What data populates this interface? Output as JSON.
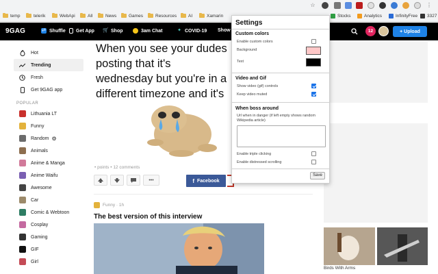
{
  "bookmarks": [
    {
      "label": "temp",
      "type": "folder"
    },
    {
      "label": "telerik",
      "type": "folder"
    },
    {
      "label": "WebApi",
      "type": "folder"
    },
    {
      "label": "All",
      "type": "folder"
    },
    {
      "label": "News",
      "type": "folder"
    },
    {
      "label": "Games",
      "type": "folder"
    },
    {
      "label": "Resources",
      "type": "folder"
    },
    {
      "label": "AI",
      "type": "folder"
    },
    {
      "label": "Xamarin",
      "type": "folder"
    },
    {
      "label": "Stocks",
      "type": "site"
    },
    {
      "label": "Analytics",
      "type": "site"
    },
    {
      "label": "InfinityFree",
      "type": "site"
    },
    {
      "label": "3327",
      "type": "site"
    }
  ],
  "header": {
    "logo": "9GAG",
    "nav": [
      {
        "label": "Shuffle",
        "icon": "shuffle-icon"
      },
      {
        "label": "Get App",
        "icon": "phone-icon"
      },
      {
        "label": "Shop",
        "icon": "cart-icon"
      },
      {
        "label": "3am Chat",
        "icon": "moon-icon"
      },
      {
        "label": "COVID-19",
        "icon": "virus-icon"
      },
      {
        "label": "Show",
        "icon": ""
      }
    ],
    "notifications": "12",
    "upload": "+ Upload"
  },
  "sidebar": {
    "top_items": [
      {
        "label": "Hot",
        "icon": "fire-icon"
      },
      {
        "label": "Trending",
        "icon": "trending-icon",
        "active": true
      },
      {
        "label": "Fresh",
        "icon": "clock-icon"
      },
      {
        "label": "Get 9GAG app",
        "icon": "phone-icon"
      }
    ],
    "popular_label": "POPULAR",
    "popular_items": [
      {
        "label": "Lithuania LT",
        "color": "#c9302c"
      },
      {
        "label": "Funny",
        "color": "#e3b23c"
      },
      {
        "label": "Random",
        "color": "#6b6b6b"
      },
      {
        "label": "Animals",
        "color": "#8d6e4f"
      },
      {
        "label": "Anime & Manga",
        "color": "#d17a9a"
      },
      {
        "label": "Anime Waifu",
        "color": "#7a5fb2"
      },
      {
        "label": "Awesome",
        "color": "#444444"
      },
      {
        "label": "Car",
        "color": "#9c8a6a"
      },
      {
        "label": "Comic & Webtoon",
        "color": "#2e7d63"
      },
      {
        "label": "Cosplay",
        "color": "#c46aa0"
      },
      {
        "label": "Gaming",
        "color": "#333333"
      },
      {
        "label": "GIF",
        "color": "#111111"
      },
      {
        "label": "Girl",
        "color": "#c44b56"
      }
    ]
  },
  "post": {
    "text": "When you see your dudes posting that it's wednesday but you're in a different timezone and it's still tuesday for you.",
    "meta": "• points • 12 comments",
    "share_label": "Facebook"
  },
  "post2": {
    "section": "Funny · 1h",
    "title": "The best version of this interview"
  },
  "right": {
    "caption": "Birds With Arms"
  },
  "settings": {
    "title": "Settings",
    "custom_colors": {
      "heading": "Custom colors",
      "enable_label": "Enable custom colors",
      "enable": false,
      "background_label": "Background",
      "background_color": "#ffc8c8",
      "text_label": "Text",
      "text_color": "#000000"
    },
    "video": {
      "heading": "Video and Gif",
      "controls_label": "Show video (gif) controls",
      "controls": true,
      "muted_label": "Keep video muted",
      "muted": true
    },
    "boss": {
      "heading": "When boss around",
      "url_label": "Url when in danger (if left empty shows random Wikipedia article)",
      "triple_label": "Enable triple clicking",
      "triple": false,
      "scroll_label": "Enable distressed scrolling",
      "scroll": false
    },
    "save": "Save"
  }
}
